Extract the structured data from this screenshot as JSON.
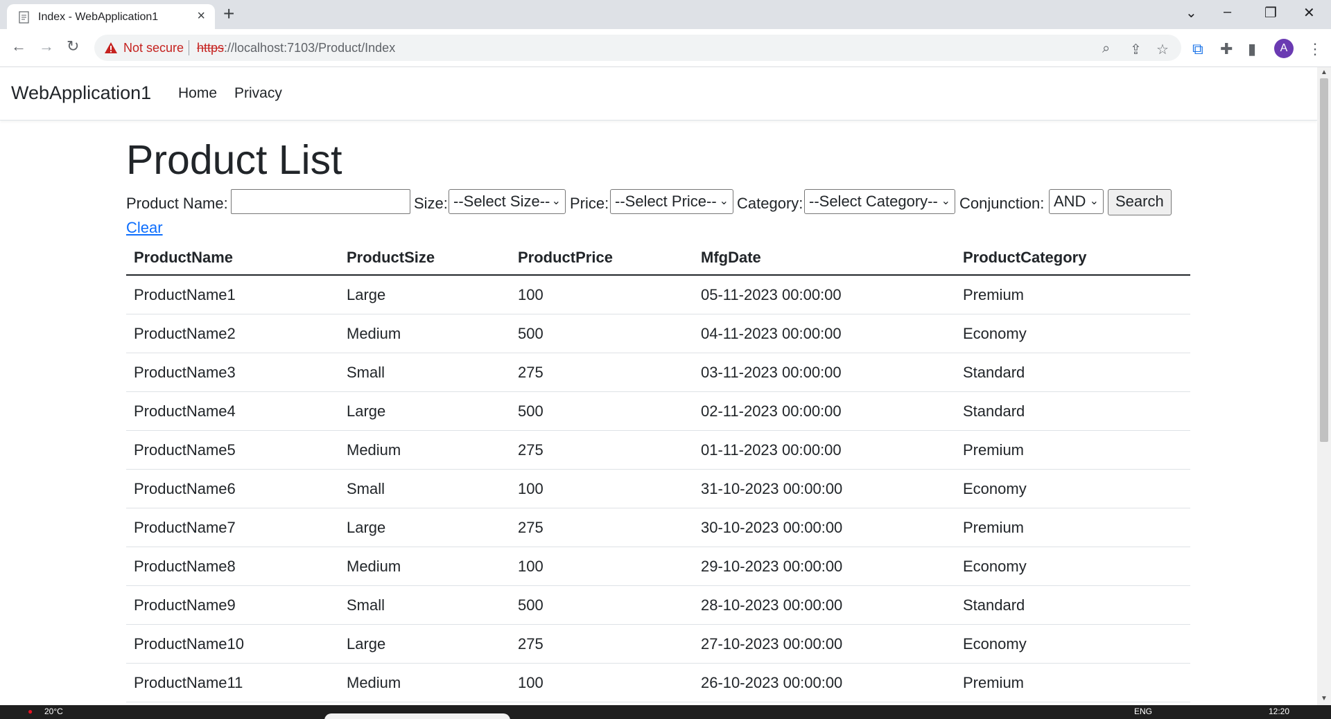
{
  "browser": {
    "tab_title": "Index - WebApplication1",
    "security_label": "Not secure",
    "url_scheme": "https",
    "url_rest": "://localhost:7103/Product/Index",
    "avatar_initial": "A"
  },
  "site": {
    "brand": "WebApplication1",
    "nav": [
      "Home",
      "Privacy"
    ]
  },
  "page_title": "Product List",
  "filter_form": {
    "product_name_label": "Product Name:",
    "product_name_value": "",
    "size_label": "Size:",
    "size_selected": "--Select Size--",
    "price_label": "Price:",
    "price_selected": "--Select Price--",
    "category_label": "Category:",
    "category_selected": "--Select Category--",
    "conjunction_label": "Conjunction:",
    "conjunction_selected": "AND",
    "search_label": "Search",
    "clear_label": "Clear"
  },
  "table": {
    "headers": [
      "ProductName",
      "ProductSize",
      "ProductPrice",
      "MfgDate",
      "ProductCategory"
    ],
    "rows": [
      [
        "ProductName1",
        "Large",
        "100",
        "05-11-2023 00:00:00",
        "Premium"
      ],
      [
        "ProductName2",
        "Medium",
        "500",
        "04-11-2023 00:00:00",
        "Economy"
      ],
      [
        "ProductName3",
        "Small",
        "275",
        "03-11-2023 00:00:00",
        "Standard"
      ],
      [
        "ProductName4",
        "Large",
        "500",
        "02-11-2023 00:00:00",
        "Standard"
      ],
      [
        "ProductName5",
        "Medium",
        "275",
        "01-11-2023 00:00:00",
        "Premium"
      ],
      [
        "ProductName6",
        "Small",
        "100",
        "31-10-2023 00:00:00",
        "Economy"
      ],
      [
        "ProductName7",
        "Large",
        "275",
        "30-10-2023 00:00:00",
        "Premium"
      ],
      [
        "ProductName8",
        "Medium",
        "100",
        "29-10-2023 00:00:00",
        "Economy"
      ],
      [
        "ProductName9",
        "Small",
        "500",
        "28-10-2023 00:00:00",
        "Standard"
      ],
      [
        "ProductName10",
        "Large",
        "275",
        "27-10-2023 00:00:00",
        "Economy"
      ],
      [
        "ProductName11",
        "Medium",
        "100",
        "26-10-2023 00:00:00",
        "Premium"
      ]
    ]
  },
  "taskbar": {
    "weather": "20°C",
    "lang": "ENG",
    "time": "12:20"
  },
  "colors": {
    "link": "#0d6efd",
    "insecure": "#c5221f",
    "avatar": "#6a3ab2"
  }
}
